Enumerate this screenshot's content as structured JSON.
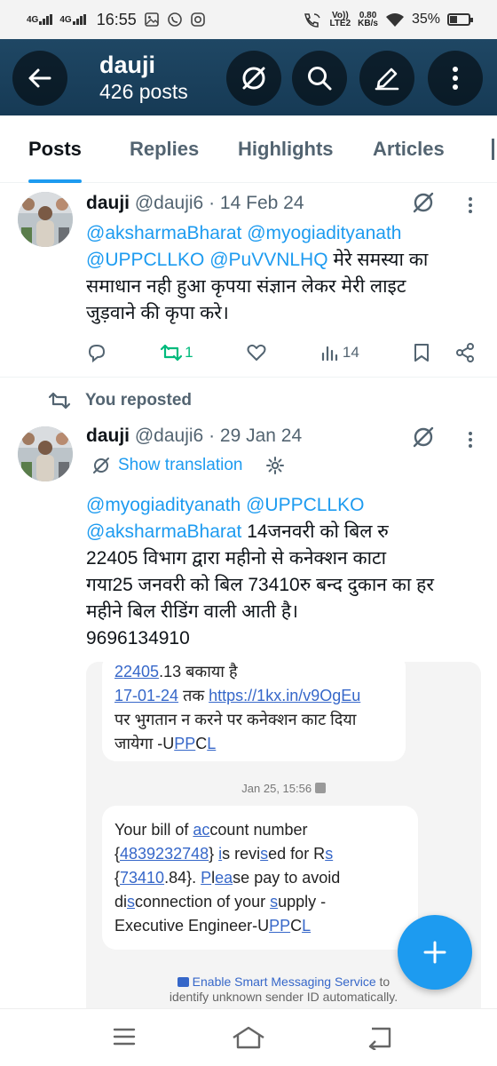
{
  "status_bar": {
    "network1": "4G",
    "network2": "4G",
    "time": "16:55",
    "volte": "Vo))",
    "lte": "LTE2",
    "speed_value": "0.80",
    "speed_unit": "KB/s",
    "battery": "35%"
  },
  "header": {
    "name": "dauji",
    "posts_count": "426 posts",
    "icons": [
      "back-arrow-icon",
      "grok-icon",
      "search-icon",
      "compose-icon",
      "more-vertical-icon"
    ]
  },
  "tabs": [
    {
      "label": "Posts",
      "active": true
    },
    {
      "label": "Replies",
      "active": false
    },
    {
      "label": "Highlights",
      "active": false
    },
    {
      "label": "Articles",
      "active": false
    }
  ],
  "tweet1": {
    "name": "dauji",
    "handle": "@dauji6",
    "sep": "·",
    "date": "14 Feb 24",
    "mentions_line1": "@aksharmaBharat @myogiadityanath",
    "mentions_line2": "@UPPCLLKO @PuVVNLHQ",
    "text_after_mentions": " मेरे समस्या का",
    "text_line3": "समाधान नही हुआ कृपया संज्ञान लेकर मेरी लाइट",
    "text_line4": "जुड़वाने की कृपा करे।",
    "retweets": "1",
    "views": "14"
  },
  "repost_label": "You reposted",
  "tweet2": {
    "name": "dauji",
    "handle": "@dauji6",
    "sep": "·",
    "date": "29 Jan 24",
    "show_translation": "Show translation",
    "mentions_line1": "@myogiadityanath @UPPCLLKO",
    "mention_line2": "@aksharmaBharat",
    "text_after_line2": " 14जनवरी को बिल रु",
    "text_line3": "22405 विभाग द्वारा महीनो से कनेक्शन काटा",
    "text_line4": "गया25 जनवरी को बिल 73410रु बन्द दुकान का हर",
    "text_line5": "महीने बिल रीडिंग वाली आती है।",
    "text_line6": "9696134910"
  },
  "sms": {
    "bubble1": {
      "l1a": "22405",
      "l1b": ".13 बकाया है",
      "l2a": "17-01-24",
      "l2b": " तक ",
      "l2c": "https://1kx.in/v9OgEu",
      "l3": "पर भुगतान न करने पर कनेक्शन काट दिया",
      "l4a": "जायेगा -U",
      "l4b": "PP",
      "l4c": "C",
      "l4d": "L"
    },
    "date": "Jan 25, 15:56",
    "bubble2": {
      "l1a": "Your bill of ",
      "l1b": "ac",
      "l1c": "count number",
      "l2a": "{",
      "l2b": "4839232748",
      "l2c": "} ",
      "l2d": "i",
      "l2e": "s revi",
      "l2f": "s",
      "l2g": "ed for R",
      "l2h": "s",
      "l3a": "{",
      "l3b": "73410",
      "l3c": ".84}. ",
      "l3d": "P",
      "l3e": "l",
      "l3f": "ea",
      "l3g": "se",
      "l3h": " pay to avoid",
      "l4a": "di",
      "l4b": "s",
      "l4c": "connection of your ",
      "l4d": "s",
      "l4e": "upply -",
      "l5a": "Executive Engineer-U",
      "l5b": "PP",
      "l5c": "C",
      "l5d": "L"
    },
    "smart_link": "Enable Smart Messaging Service",
    "smart_to": " to",
    "smart_line2": "identify unknown sender ID automatically."
  },
  "colors": {
    "accent": "#1d9bf0",
    "retweet_green": "#00ba7c",
    "header_navy": "#1f4764"
  }
}
